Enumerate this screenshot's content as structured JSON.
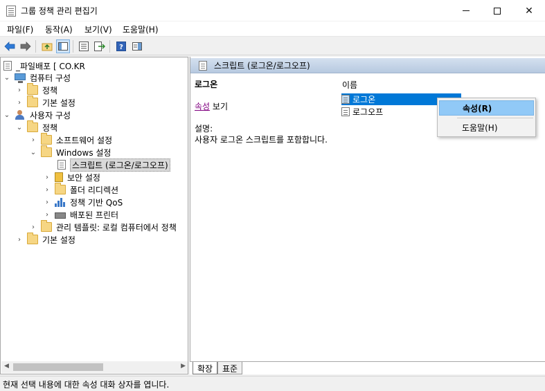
{
  "window": {
    "title": "그룹 정책 관리 편집기"
  },
  "menu": [
    "파일(F)",
    "동작(A)",
    "보기(V)",
    "도움말(H)"
  ],
  "tree": {
    "root": "_파일배포 [ CO.KR",
    "items": {
      "computer_config": "컴퓨터 구성",
      "computer_policy": "정책",
      "computer_prefs": "기본 설정",
      "user_config": "사용자 구성",
      "user_policy": "정책",
      "software": "소프트웨어 설정",
      "windows": "Windows 설정",
      "scripts": "스크립트 (로그온/로그오프)",
      "security": "보안 설정",
      "folder_redirect": "폴더 리디렉션",
      "qos": "정책 기반 QoS",
      "printers": "배포된 프린터",
      "admin_templates": "관리 템플릿: 로컬 컴퓨터에서 정책",
      "user_prefs": "기본 설정"
    }
  },
  "right": {
    "header": "스크립트 (로그온/로그오프)",
    "desc_title": "로그온",
    "link": "속성",
    "link_suffix": " 보기",
    "desc_label": "설명:",
    "desc_text": "사용자 로그온 스크립트를 포함합니다.",
    "column": "이름",
    "items": [
      "로그온",
      "로그오프"
    ]
  },
  "tabs": [
    "확장",
    "표준"
  ],
  "context_menu": [
    "속성(R)",
    "도움말(H)"
  ],
  "status": "현재 선택 내용에 대한 속성 대화 상자를 엽니다."
}
